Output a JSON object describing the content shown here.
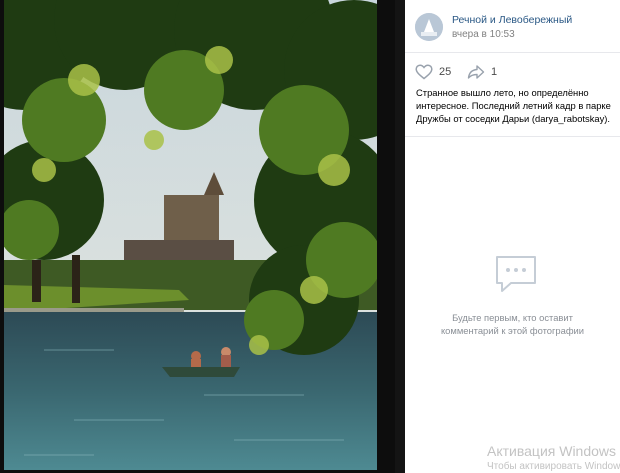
{
  "post": {
    "author": "Речной и Левобережный",
    "time": "вчера в 10:53",
    "likes": "25",
    "shares": "1",
    "description": "Странное вышло лето, но определённо интересное. Последний летний кадр в парке Дружбы от соседки Дарьи (darya_rabotskay)."
  },
  "comments": {
    "empty_text": "Будьте первым, кто оставит комментарий к этой фотографии"
  },
  "watermark": {
    "line1": "Активация Windows",
    "line2": "Чтобы активировать Windows"
  },
  "icons": [
    "heart-icon",
    "share-icon",
    "comment-bubble-icon"
  ],
  "colors": {
    "author_link": "#2a5885",
    "muted": "#828282"
  }
}
